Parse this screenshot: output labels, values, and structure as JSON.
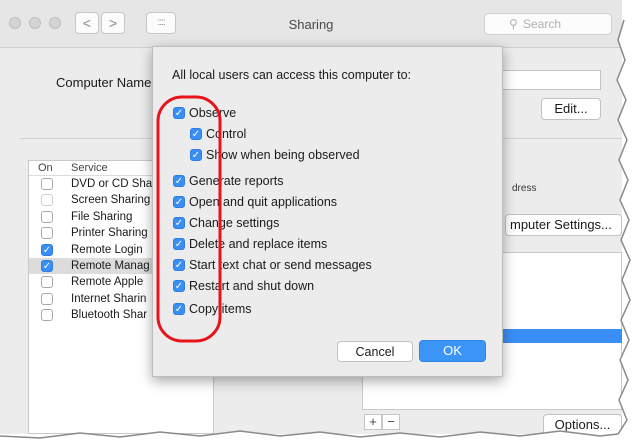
{
  "window": {
    "title": "Sharing",
    "search_placeholder": "Search",
    "search_icon": "magnifier-icon",
    "nav_back": "<",
    "nav_forward": ">",
    "grid_icon": "::::"
  },
  "main": {
    "computer_name_label": "Computer Name:",
    "edit_button": "Edit...",
    "right_text": "dress",
    "computer_settings_button": "mputer Settings...",
    "options_button": "Options...",
    "add_button": "+",
    "remove_button": "−"
  },
  "service_list": {
    "header_on": "On",
    "header_service": "Service",
    "items": [
      {
        "label": "DVD or CD Sha",
        "checked": false,
        "dim": false,
        "selected": false
      },
      {
        "label": "Screen Sharing",
        "checked": false,
        "dim": true,
        "selected": false
      },
      {
        "label": "File Sharing",
        "checked": false,
        "dim": false,
        "selected": false
      },
      {
        "label": "Printer Sharing",
        "checked": false,
        "dim": false,
        "selected": false
      },
      {
        "label": "Remote Login",
        "checked": true,
        "dim": false,
        "selected": false
      },
      {
        "label": "Remote Manag",
        "checked": true,
        "dim": false,
        "selected": true
      },
      {
        "label": "Remote Apple",
        "checked": false,
        "dim": false,
        "selected": false
      },
      {
        "label": "Internet Sharin",
        "checked": false,
        "dim": false,
        "selected": false
      },
      {
        "label": "Bluetooth Shar",
        "checked": false,
        "dim": false,
        "selected": false
      }
    ]
  },
  "sheet": {
    "heading": "All local users can access this computer to:",
    "options": [
      {
        "label": "Observe",
        "checked": true,
        "indent": false
      },
      {
        "label": "Control",
        "checked": true,
        "indent": true
      },
      {
        "label": "Show when being observed",
        "checked": true,
        "indent": true
      },
      {
        "label": "Generate reports",
        "checked": true,
        "indent": false
      },
      {
        "label": "Open and quit applications",
        "checked": true,
        "indent": false
      },
      {
        "label": "Change settings",
        "checked": true,
        "indent": false
      },
      {
        "label": "Delete and replace items",
        "checked": true,
        "indent": false
      },
      {
        "label": "Start text chat or send messages",
        "checked": true,
        "indent": false
      },
      {
        "label": "Restart and shut down",
        "checked": true,
        "indent": false
      },
      {
        "label": "Copy items",
        "checked": true,
        "indent": false
      }
    ],
    "cancel_button": "Cancel",
    "ok_button": "OK"
  },
  "colors": {
    "accent": "#3b8ef5",
    "annotation": "#e8141b"
  }
}
